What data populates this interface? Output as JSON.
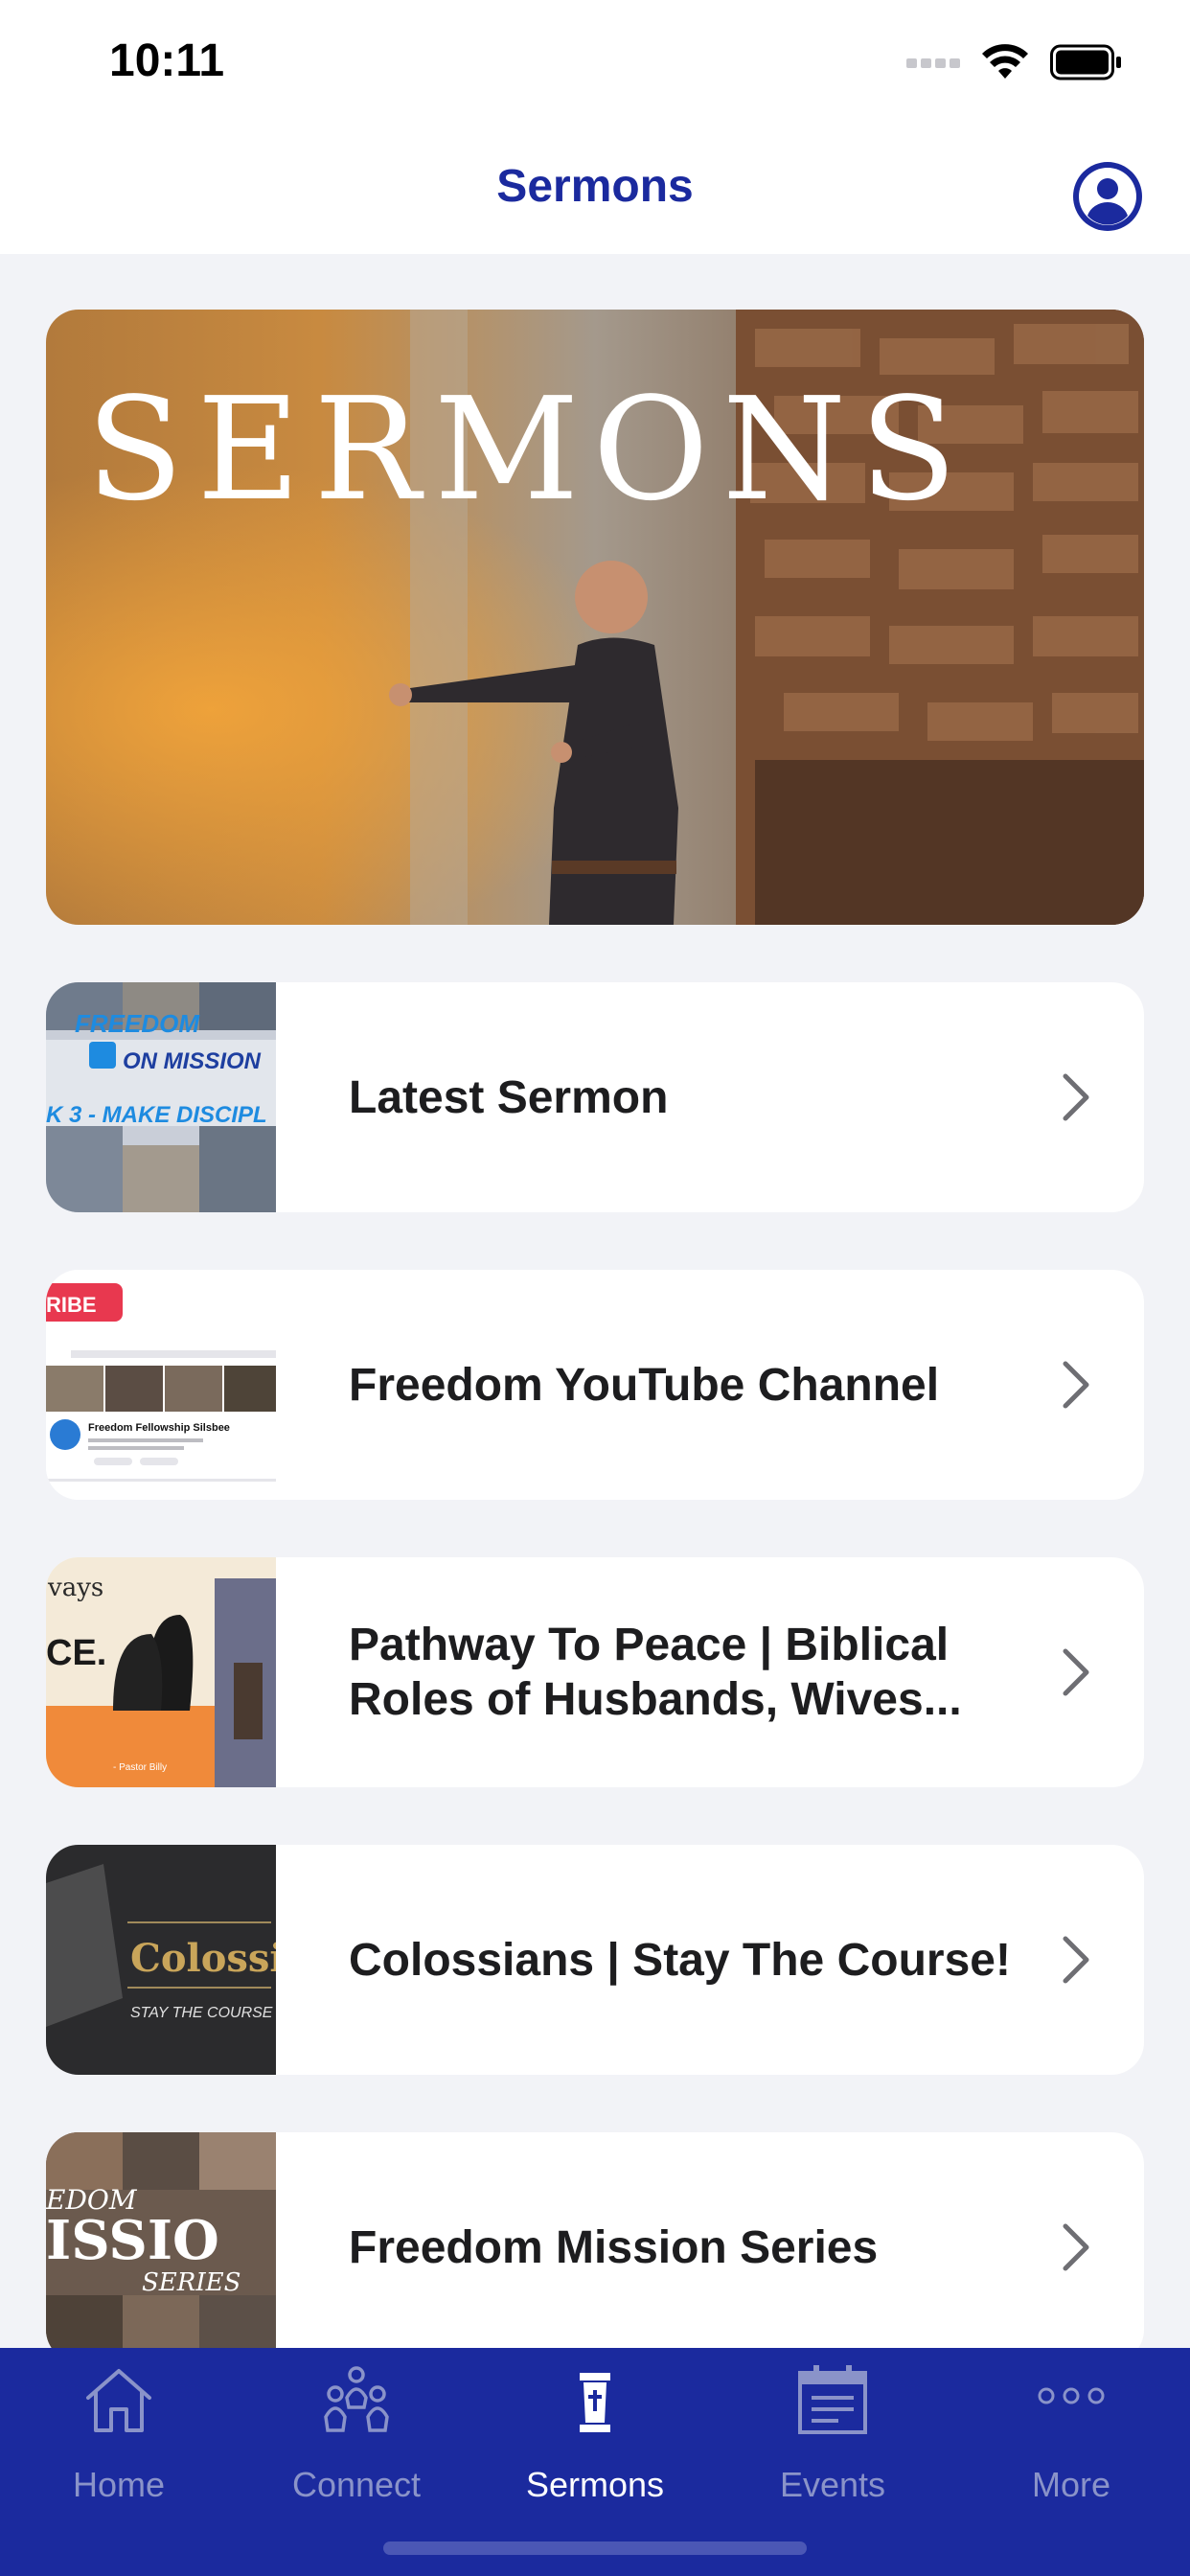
{
  "status_bar": {
    "time": "10:11"
  },
  "header": {
    "title": "Sermons"
  },
  "hero": {
    "title": "SERMONS"
  },
  "items": [
    {
      "label": "Latest Sermon",
      "thumb_text": [
        "FREEDOM",
        "ON MISSION",
        "K 3 - MAKE DISCIPL"
      ]
    },
    {
      "label": "Freedom YouTube Channel",
      "thumb_text": [
        "RIBE",
        "Freedom Fellowship Silsbee"
      ]
    },
    {
      "label": "Pathway To Peace | Biblical Roles of Husbands, Wives...",
      "thumb_text": [
        "vays",
        "CE.",
        "- Pastor Billy"
      ]
    },
    {
      "label": "Colossians | Stay The Course!",
      "thumb_text": [
        "Colossi",
        "STAY THE COURSE"
      ]
    },
    {
      "label": "Freedom Mission Series",
      "thumb_text": [
        "EDOM",
        "ISSIO",
        "SERIES"
      ]
    }
  ],
  "tabs": [
    {
      "label": "Home",
      "icon": "home-icon"
    },
    {
      "label": "Connect",
      "icon": "people-icon"
    },
    {
      "label": "Sermons",
      "icon": "pulpit-icon"
    },
    {
      "label": "Events",
      "icon": "calendar-icon"
    },
    {
      "label": "More",
      "icon": "ellipsis-icon"
    }
  ],
  "colors": {
    "brand": "#1b2a9e",
    "background": "#f2f3f7",
    "tab_inactive": "#8a93c9"
  }
}
